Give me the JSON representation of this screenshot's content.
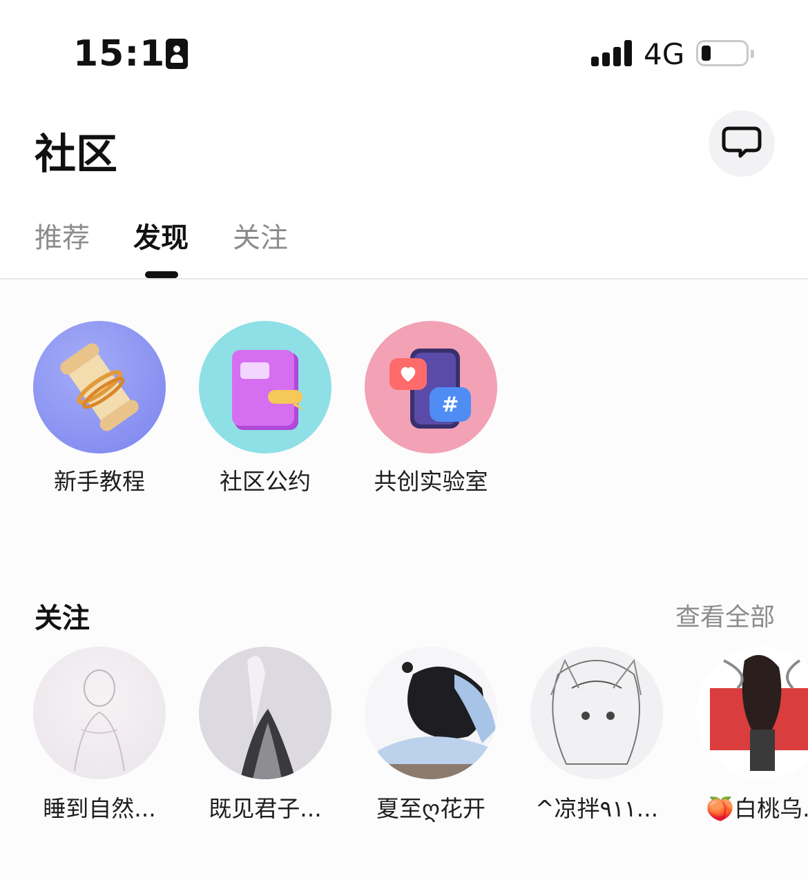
{
  "status_bar": {
    "time": "15:11",
    "network": "4G",
    "battery_level": 0.15
  },
  "header": {
    "title": "社区",
    "chat_icon": "chat-bubble-icon"
  },
  "tabs": [
    {
      "label": "推荐",
      "active": false
    },
    {
      "label": "发现",
      "active": true
    },
    {
      "label": "关注",
      "active": false
    }
  ],
  "shortcuts": [
    {
      "label": "新手教程",
      "icon": "scroll-icon",
      "color": "#8e97f3"
    },
    {
      "label": "社区公约",
      "icon": "notebook-icon",
      "color": "#8ee0e6"
    },
    {
      "label": "共创实验室",
      "icon": "phone-hashtag-icon",
      "color": "#f2a2b4"
    }
  ],
  "following": {
    "title": "关注",
    "see_all": "查看全部",
    "users": [
      {
        "name": "睡到自然..."
      },
      {
        "name": "既见君子..."
      },
      {
        "name": "夏至ღ花开"
      },
      {
        "name": "^凉拌٩١١..."
      },
      {
        "name": "🍑白桃乌..."
      }
    ]
  }
}
